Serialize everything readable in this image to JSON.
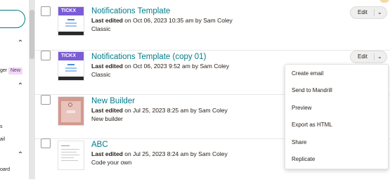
{
  "sidebar": {
    "frag_new_prefix": "ger",
    "badge_new": "New",
    "frag_s": "s",
    "frag_ail": "ail",
    "frag_board": "oard"
  },
  "templates": [
    {
      "name": "Notifications Template",
      "edited_label": "Last edited",
      "edited_text": "on Oct 06, 2023 10:35 am by Sam Coley",
      "type": "Classic",
      "thumb_logo": "TICKX",
      "edit_label": "Edit"
    },
    {
      "name": "Notifications Template (copy 01)",
      "edited_label": "Last edited",
      "edited_text": "on Oct 06, 2023 9:52 am by Sam Coley",
      "type": "Classic",
      "thumb_logo": "TICKX",
      "edit_label": "Edit"
    },
    {
      "name": "New Builder",
      "edited_label": "Last edited",
      "edited_text": "on Jul 25, 2023 8:25 am by Sam Coley",
      "type": "New builder"
    },
    {
      "name": "ABC",
      "edited_label": "Last edited",
      "edited_text": "on Jul 25, 2023 8:24 am by Sam Coley",
      "type": "Code your own"
    }
  ],
  "menu": {
    "items": [
      "Create email",
      "Send to Mandrill",
      "Preview",
      "Export as HTML",
      "Share",
      "Replicate"
    ]
  },
  "colors": {
    "link": "#007c89",
    "new_badge_bg": "#efd9f4",
    "tickx_header": "#7b5cd6"
  }
}
